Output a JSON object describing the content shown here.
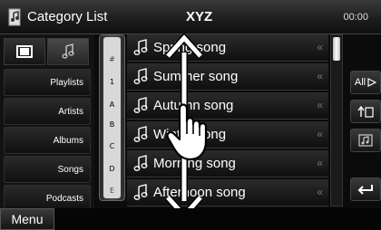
{
  "header": {
    "title": "Category List",
    "center": "XYZ",
    "time": "00:00"
  },
  "left_panel": {
    "categories": [
      "Playlists",
      "Artists",
      "Albums",
      "Songs",
      "Podcasts"
    ]
  },
  "index_bar": {
    "items": [
      "#",
      "1",
      "A",
      "B",
      "C",
      "D",
      "E"
    ]
  },
  "songs": [
    {
      "title": "Spring song"
    },
    {
      "title": "Summer song"
    },
    {
      "title": "Autumn song"
    },
    {
      "title": "Winter song"
    },
    {
      "title": "Morning song"
    },
    {
      "title": "Afternoon song"
    }
  ],
  "right_panel": {
    "all_label": "All"
  },
  "bottom": {
    "menu_label": "Menu"
  },
  "colors": {
    "background": "#0b0b0b",
    "text": "#ffffff",
    "index_bar": "#d8d8d8"
  }
}
